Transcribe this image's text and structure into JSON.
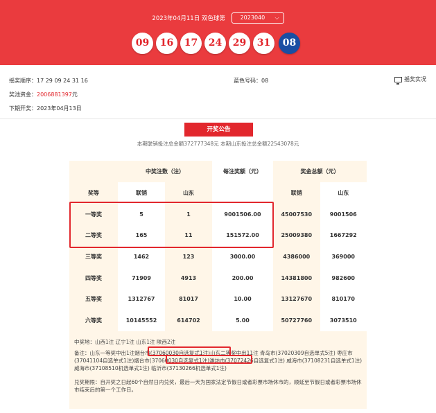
{
  "header": {
    "date_text": "2023年04月11日 双色球第",
    "issue": "2023040",
    "chevron_icon": "chevron-down-icon"
  },
  "balls": {
    "red": [
      "09",
      "16",
      "17",
      "24",
      "29",
      "31"
    ],
    "blue": "08"
  },
  "info": {
    "order": "摇奖顺序：17  29  09  24  31  16",
    "blue_label": "蓝色号码：08",
    "pool_label": "奖池资金：",
    "pool_value": "2006881397",
    "pool_unit": "元",
    "next_draw": "下期开奖：2023年04月13日",
    "replay": "摇奖实况",
    "replay_icon": "monitor-icon"
  },
  "announcement": {
    "button": "开奖公告",
    "sales": "本期联销投注总金额372777348元 本期山东投注总金额22543078元"
  },
  "table": {
    "group_headers": [
      "中奖注数（注）",
      "每注奖额（元）",
      "奖金总额（元）"
    ],
    "sub_headers": [
      "奖等",
      "联销",
      "山东",
      "联销",
      "山东"
    ],
    "rows": [
      [
        "一等奖",
        "5",
        "1",
        "9001506.00",
        "45007530",
        "9001506"
      ],
      [
        "二等奖",
        "165",
        "11",
        "151572.00",
        "25009380",
        "1667292"
      ],
      [
        "三等奖",
        "1462",
        "123",
        "3000.00",
        "4386000",
        "369000"
      ],
      [
        "四等奖",
        "71909",
        "4913",
        "200.00",
        "14381800",
        "982600"
      ],
      [
        "五等奖",
        "1312767",
        "81017",
        "10.00",
        "13127670",
        "810170"
      ],
      [
        "六等奖",
        "10145552",
        "614702",
        "5.00",
        "50727760",
        "3073510"
      ]
    ]
  },
  "notes": {
    "winners": "中奖地：山西1注 辽宁1注 山东1注 陕西2注",
    "remark": "备注：山东一等奖中出1注烟台市(37060030自选复式1注)山东二等奖中出11注 青岛市(37020309自选单式5注) 枣庄市(37041104自选单式1注)烟台市(37060030自选复式1注)潍坊市(37072426自选复式1注) 威海市(37108231自选单式1注) 威海市(37108510机选单式1注) 临沂市(37130266机选单式1注)",
    "period": "兑奖期限：自开奖之日起60个自然日内兑奖，最后一天为国家法定节假日或者彩票市场休市的，顺延至节假日或者彩票市场休市结束后的第一个工作日。"
  },
  "colors": {
    "banner": "#ea3b3e",
    "red_ball_text": "#e2272d",
    "blue_ball": "#1a4ea3",
    "panel": "#fff6e8",
    "highlight": "#e2272d"
  }
}
